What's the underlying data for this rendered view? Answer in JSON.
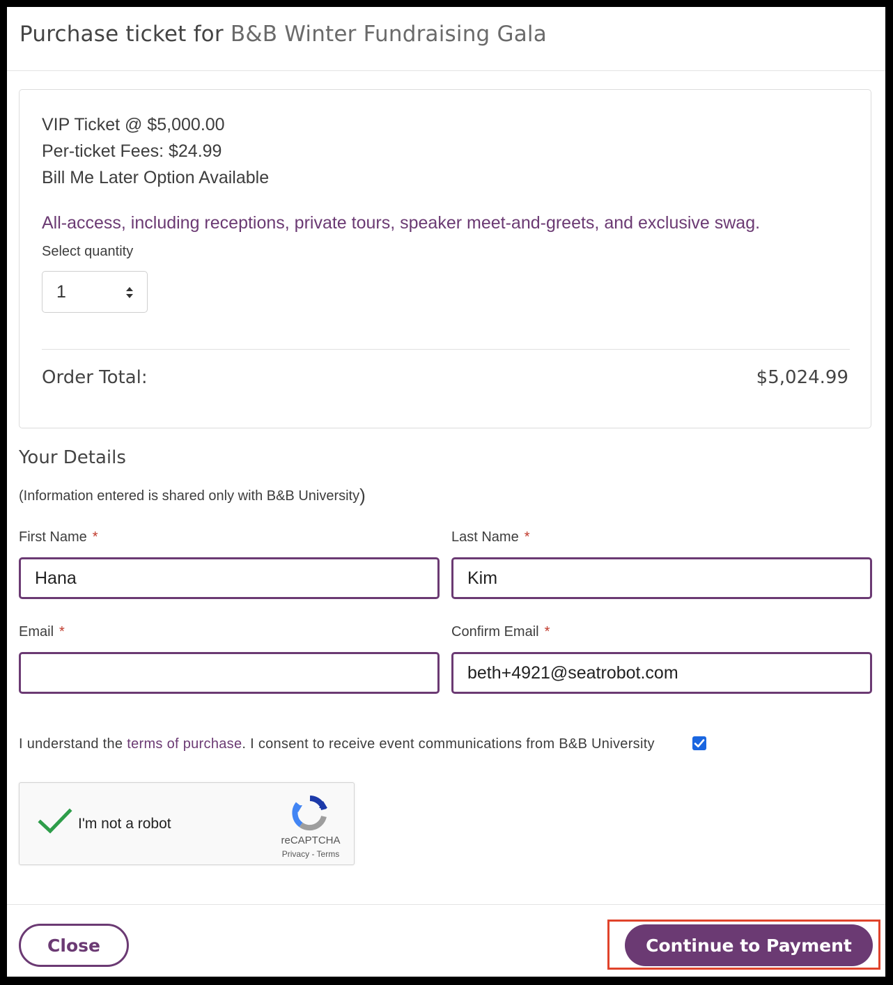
{
  "header": {
    "title_prefix": "Purchase ticket for ",
    "event_name": "B&B Winter Fundraising Gala"
  },
  "ticket": {
    "line1": "VIP Ticket @ $5,000.00",
    "line2": "Per-ticket Fees: $24.99",
    "line3": "Bill Me Later Option Available",
    "description": "All-access, including receptions, private tours, speaker meet-and-greets, and exclusive swag.",
    "quantity_label": "Select quantity",
    "quantity_value": "1",
    "total_label": "Order Total:",
    "total_value": "$5,024.99"
  },
  "details": {
    "title": "Your Details",
    "note_open": "(",
    "note": "Information entered is shared only with B&B University",
    "note_close": ")",
    "required_mark": "*",
    "first_name_label": "First Name",
    "first_name_value": "Hana",
    "last_name_label": "Last Name",
    "last_name_value": "Kim",
    "email_label": "Email",
    "email_value": "",
    "confirm_email_label": "Confirm Email",
    "confirm_email_value": "beth+4921@seatrobot.com"
  },
  "consent": {
    "prefix": "I understand the ",
    "link": "terms of purchase",
    "suffix": ". I consent to receive event communications from B&B University",
    "checked": true
  },
  "captcha": {
    "label": "I'm not a robot",
    "brand": "reCAPTCHA",
    "links": "Privacy - Terms",
    "checked": true
  },
  "footer": {
    "close_label": "Close",
    "continue_label": "Continue to Payment"
  },
  "colors": {
    "accent": "#6b3a73",
    "required": "#c0392b",
    "highlight": "#e0432b",
    "checkbox": "#1a66e0"
  }
}
